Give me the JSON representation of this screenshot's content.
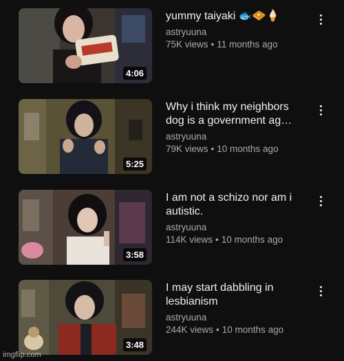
{
  "videos": [
    {
      "title": "yummy taiyaki 🐟🧇🍦",
      "channel": "astryuuna",
      "views": "75K views",
      "age": "11 months ago",
      "duration": "4:06"
    },
    {
      "title_line1": "Why i think my neighbors",
      "title_line2": "dog is a government ag…",
      "channel": "astryuuna",
      "views": "79K views",
      "age": "10 months ago",
      "duration": "5:25"
    },
    {
      "title_line1": "I am not a schizo nor am i",
      "title_line2": "autistic.",
      "channel": "astryuuna",
      "views": "114K views",
      "age": "10 months ago",
      "duration": "3:58"
    },
    {
      "title_line1": "I may start dabbling in",
      "title_line2": "lesbianism",
      "channel": "astryuuna",
      "views": "244K views",
      "age": "10 months ago",
      "duration": "3:48"
    }
  ],
  "separator": "•",
  "watermark": "imgflip.com",
  "colors": {
    "background": "#0f0f0f",
    "title_text": "#f1f1f1",
    "secondary_text": "#aaaaaa"
  },
  "icons": {
    "more": "more-vertical-icon"
  }
}
